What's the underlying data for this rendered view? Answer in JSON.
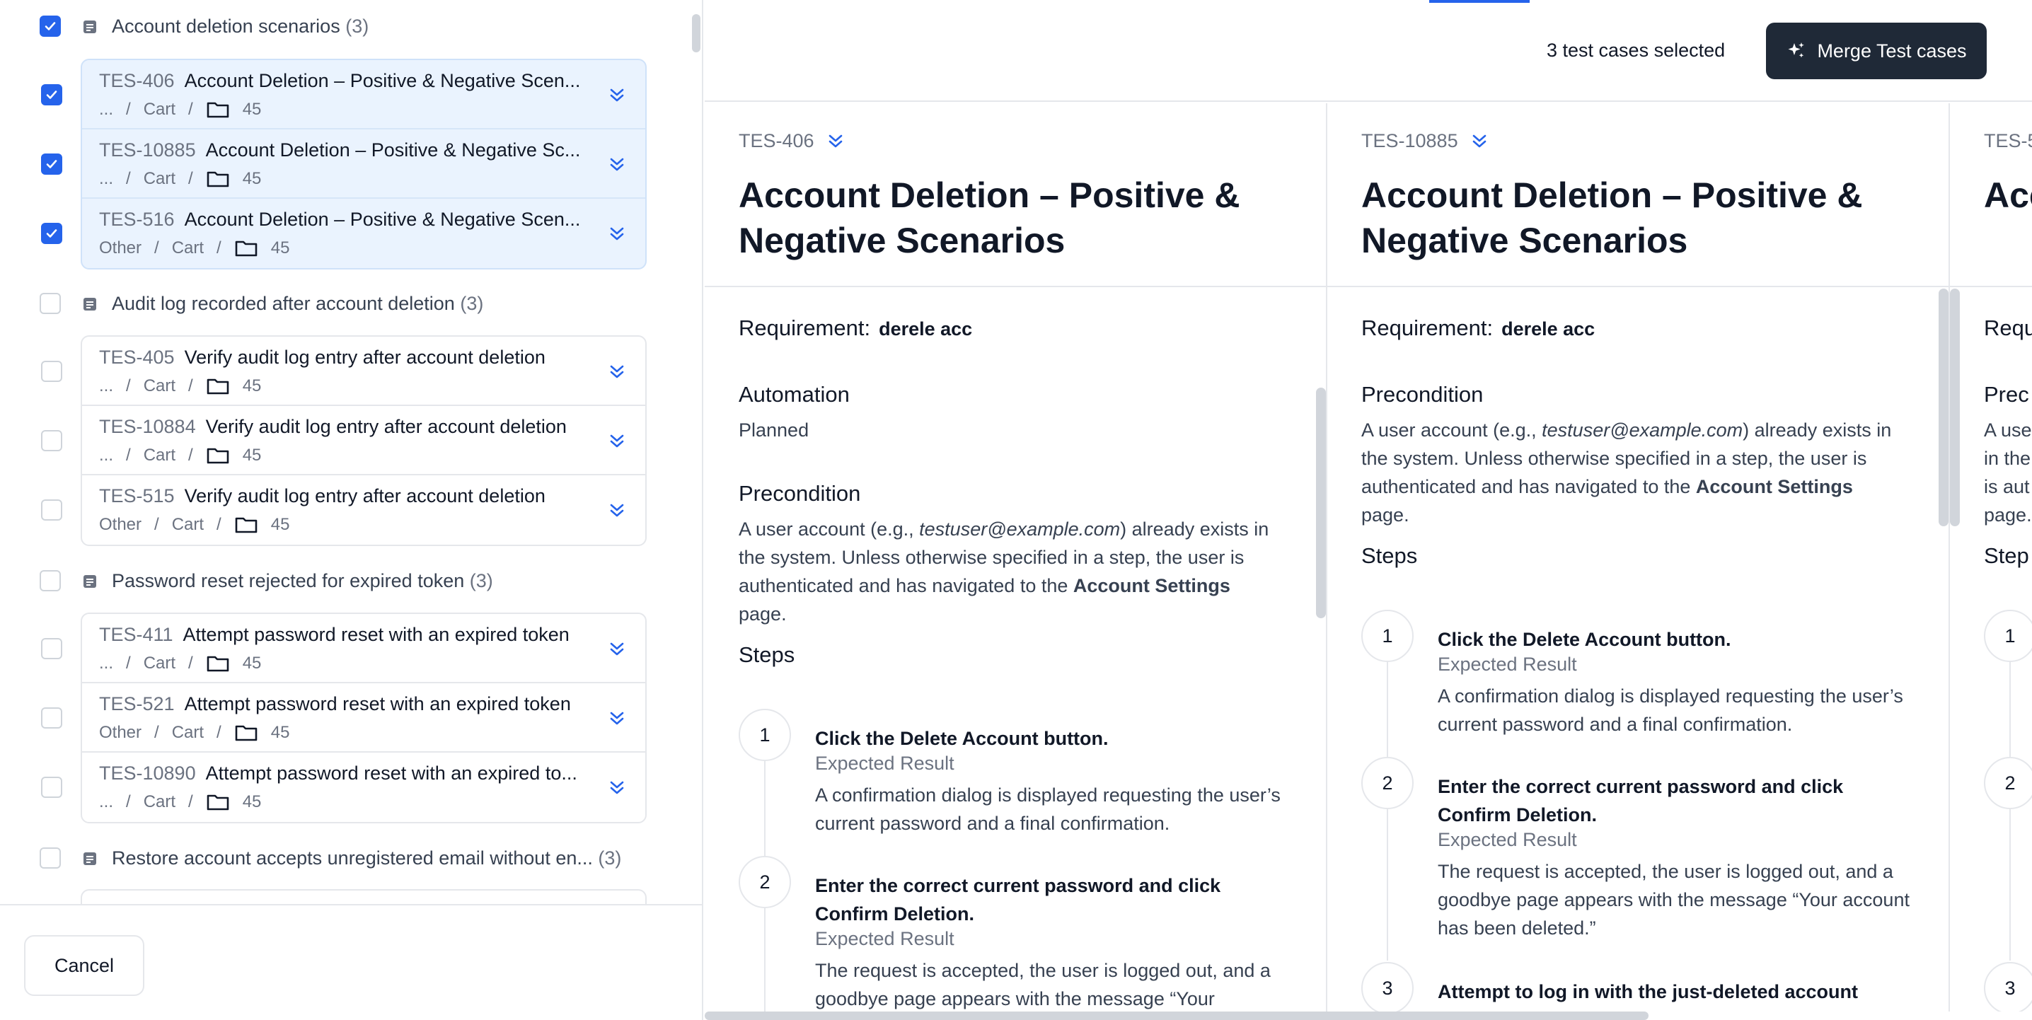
{
  "colors": {
    "accent": "#2563eb",
    "dark_button": "#1f2937",
    "selected_bg": "#eaf3fe"
  },
  "groups": [
    {
      "title": "Account deletion scenarios",
      "count": "(3)",
      "checked": true,
      "cases": [
        {
          "id": "TES-406",
          "title": "Account Deletion – Positive & Negative Scen...",
          "path": [
            "...",
            "Cart"
          ],
          "folder": "45",
          "checked": true
        },
        {
          "id": "TES-10885",
          "title": "Account Deletion – Positive & Negative Sc...",
          "path": [
            "...",
            "Cart"
          ],
          "folder": "45",
          "checked": true
        },
        {
          "id": "TES-516",
          "title": "Account Deletion – Positive & Negative Scen...",
          "path": [
            "Other",
            "Cart"
          ],
          "folder": "45",
          "checked": true
        }
      ]
    },
    {
      "title": "Audit log recorded after account deletion",
      "count": "(3)",
      "checked": false,
      "cases": [
        {
          "id": "TES-405",
          "title": "Verify audit log entry after account deletion",
          "path": [
            "...",
            "Cart"
          ],
          "folder": "45",
          "checked": false
        },
        {
          "id": "TES-10884",
          "title": "Verify audit log entry after account deletion",
          "path": [
            "...",
            "Cart"
          ],
          "folder": "45",
          "checked": false
        },
        {
          "id": "TES-515",
          "title": "Verify audit log entry after account deletion",
          "path": [
            "Other",
            "Cart"
          ],
          "folder": "45",
          "checked": false
        }
      ]
    },
    {
      "title": "Password reset rejected for expired token",
      "count": "(3)",
      "checked": false,
      "cases": [
        {
          "id": "TES-411",
          "title": "Attempt password reset with an expired token",
          "path": [
            "...",
            "Cart"
          ],
          "folder": "45",
          "checked": false
        },
        {
          "id": "TES-521",
          "title": "Attempt password reset with an expired token",
          "path": [
            "Other",
            "Cart"
          ],
          "folder": "45",
          "checked": false
        },
        {
          "id": "TES-10890",
          "title": "Attempt password reset with an expired to...",
          "path": [
            "...",
            "Cart"
          ],
          "folder": "45",
          "checked": false
        }
      ]
    },
    {
      "title": "Restore account accepts unregistered email without en...",
      "count": "(3)",
      "checked": false,
      "cases": []
    }
  ],
  "footer": {
    "cancel_label": "Cancel"
  },
  "top": {
    "selected_text": "3 test cases selected",
    "merge_label": "Merge Test cases"
  },
  "columns": [
    {
      "id": "TES-406",
      "title": "Account Deletion – Positive & Negative Scenarios",
      "requirement_label": "Requirement:",
      "requirement_value": "derele acc",
      "automation_label": "Automation",
      "automation_value": "Planned",
      "precondition_label": "Precondition",
      "precondition_parts": [
        "A user account (e.g., ",
        "testuser@example.com",
        ") already exists in the system. Unless otherwise specified in a step, the user is authenticated and has navigated to the ",
        "Account Settings",
        " page."
      ],
      "steps_label": "Steps",
      "steps": [
        {
          "num": "1",
          "action": "Click the Delete Account button.",
          "expected_label": "Expected Result",
          "expected": "A confirmation dialog is displayed requesting the user’s current password and a final confirmation."
        },
        {
          "num": "2",
          "action": "Enter the correct current password and click Confirm Deletion.",
          "expected_label": "Expected Result",
          "expected": "The request is accepted, the user is logged out, and a goodbye page appears with the message “Your"
        }
      ]
    },
    {
      "id": "TES-10885",
      "title": "Account Deletion – Positive & Negative Scenarios",
      "requirement_label": "Requirement:",
      "requirement_value": "derele acc",
      "precondition_label": "Precondition",
      "precondition_parts": [
        "A user account (e.g., ",
        "testuser@example.com",
        ") already exists in the system. Unless otherwise specified in a step, the user is authenticated and has navigated to the ",
        "Account Settings",
        " page."
      ],
      "steps_label": "Steps",
      "steps": [
        {
          "num": "1",
          "action": "Click the Delete Account button.",
          "expected_label": "Expected Result",
          "expected": "A confirmation dialog is displayed requesting the user’s current password and a final confirmation."
        },
        {
          "num": "2",
          "action": "Enter the correct current password and click Confirm Deletion.",
          "expected_label": "Expected Result",
          "expected": "The request is accepted, the user is logged out, and a goodbye page appears with the message “Your account has been deleted.”"
        },
        {
          "num": "3",
          "action": "Attempt to log in with the just-deleted account",
          "expected_label": "",
          "expected": ""
        }
      ]
    },
    {
      "id": "TES-5",
      "title": "Acc Neg",
      "requirement_label": "Requ",
      "precondition_label": "Prec",
      "precondition_lines": [
        "A use",
        "in the",
        "is aut",
        "page."
      ],
      "steps_label": "Step",
      "step_nums": [
        "1",
        "2",
        "3"
      ]
    }
  ]
}
